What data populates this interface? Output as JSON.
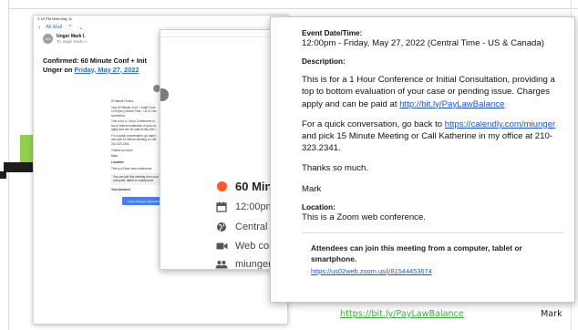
{
  "mail": {
    "status_time": "2:19 PM   Wed May 11",
    "status_right": "... 64%",
    "back_label": "All Mail",
    "sender_initials": "UM",
    "sender_name": "Unger Mark I.",
    "sender_to": "To: unger mark i >",
    "subject_prefix": "Confirmed: 60 Minute Conf + Init",
    "subject_line2_prefix": "Unger on ",
    "subject_date": "Friday, May 27, 2022",
    "body_lines": [
      "Hi Marcie Fiorino,",
      "Your 60 Minute Conf + Initial Cons",
      "12:00pm (Central Time - US & Can",
      "scheduled.",
      "This is for a 1 Hour Conference or",
      "top to bottom evaluation of your ca",
      "apply and can be paid at http://bit.l",
      "For a quick conversation, go back t",
      "and pick 15 Minute Meeting or Call",
      "210-323.2341.",
      "Thanks so much.",
      "Mark"
    ],
    "location_label": "Location:",
    "location_value": "This is a Zoom web conference.",
    "zoom_box": "You can join this meeting from your computer, tablet or smartphone.",
    "answers_label": "Your Answers",
    "button_reschedule": "Invite changes impossible",
    "button_cancel": "Need to make change"
  },
  "calendar": {
    "event_title": "60 Min",
    "time": "12:00pm",
    "timezone": "Central T",
    "location": "Web con",
    "attendee": "miunger"
  },
  "detail": {
    "datetime_label": "Event Date/Time:",
    "datetime_value": "12:00pm - Friday, May 27, 2022 (Central Time - US & Canada)",
    "description_label": "Description:",
    "description_text": "This is for a 1 Hour Conference or Initial Consultation, providing a top to bottom evaluation of your case or pending issue. Charges apply and can be paid at ",
    "description_link": "http://bit.ly/PayLawBalance",
    "quick_text_1": "For a quick conversation, go back to ",
    "quick_link": "https://calendly.com/miunger",
    "quick_text_2": " and pick 15 Minute Meeting or Call Katherine in my office at 210-323.2341.",
    "thanks": "Thanks so much.",
    "signature": "Mark",
    "location_label": "Location:",
    "location_value": "This is a Zoom web conference.",
    "attendees_text": "Attendees can join this meeting from a computer, tablet or smartphone.",
    "zoom_link": "https://us02web.zoom.us/j/81544453674"
  },
  "caption": {
    "link": "https://bit.ly/PayLawBalance",
    "name": "Mark"
  }
}
